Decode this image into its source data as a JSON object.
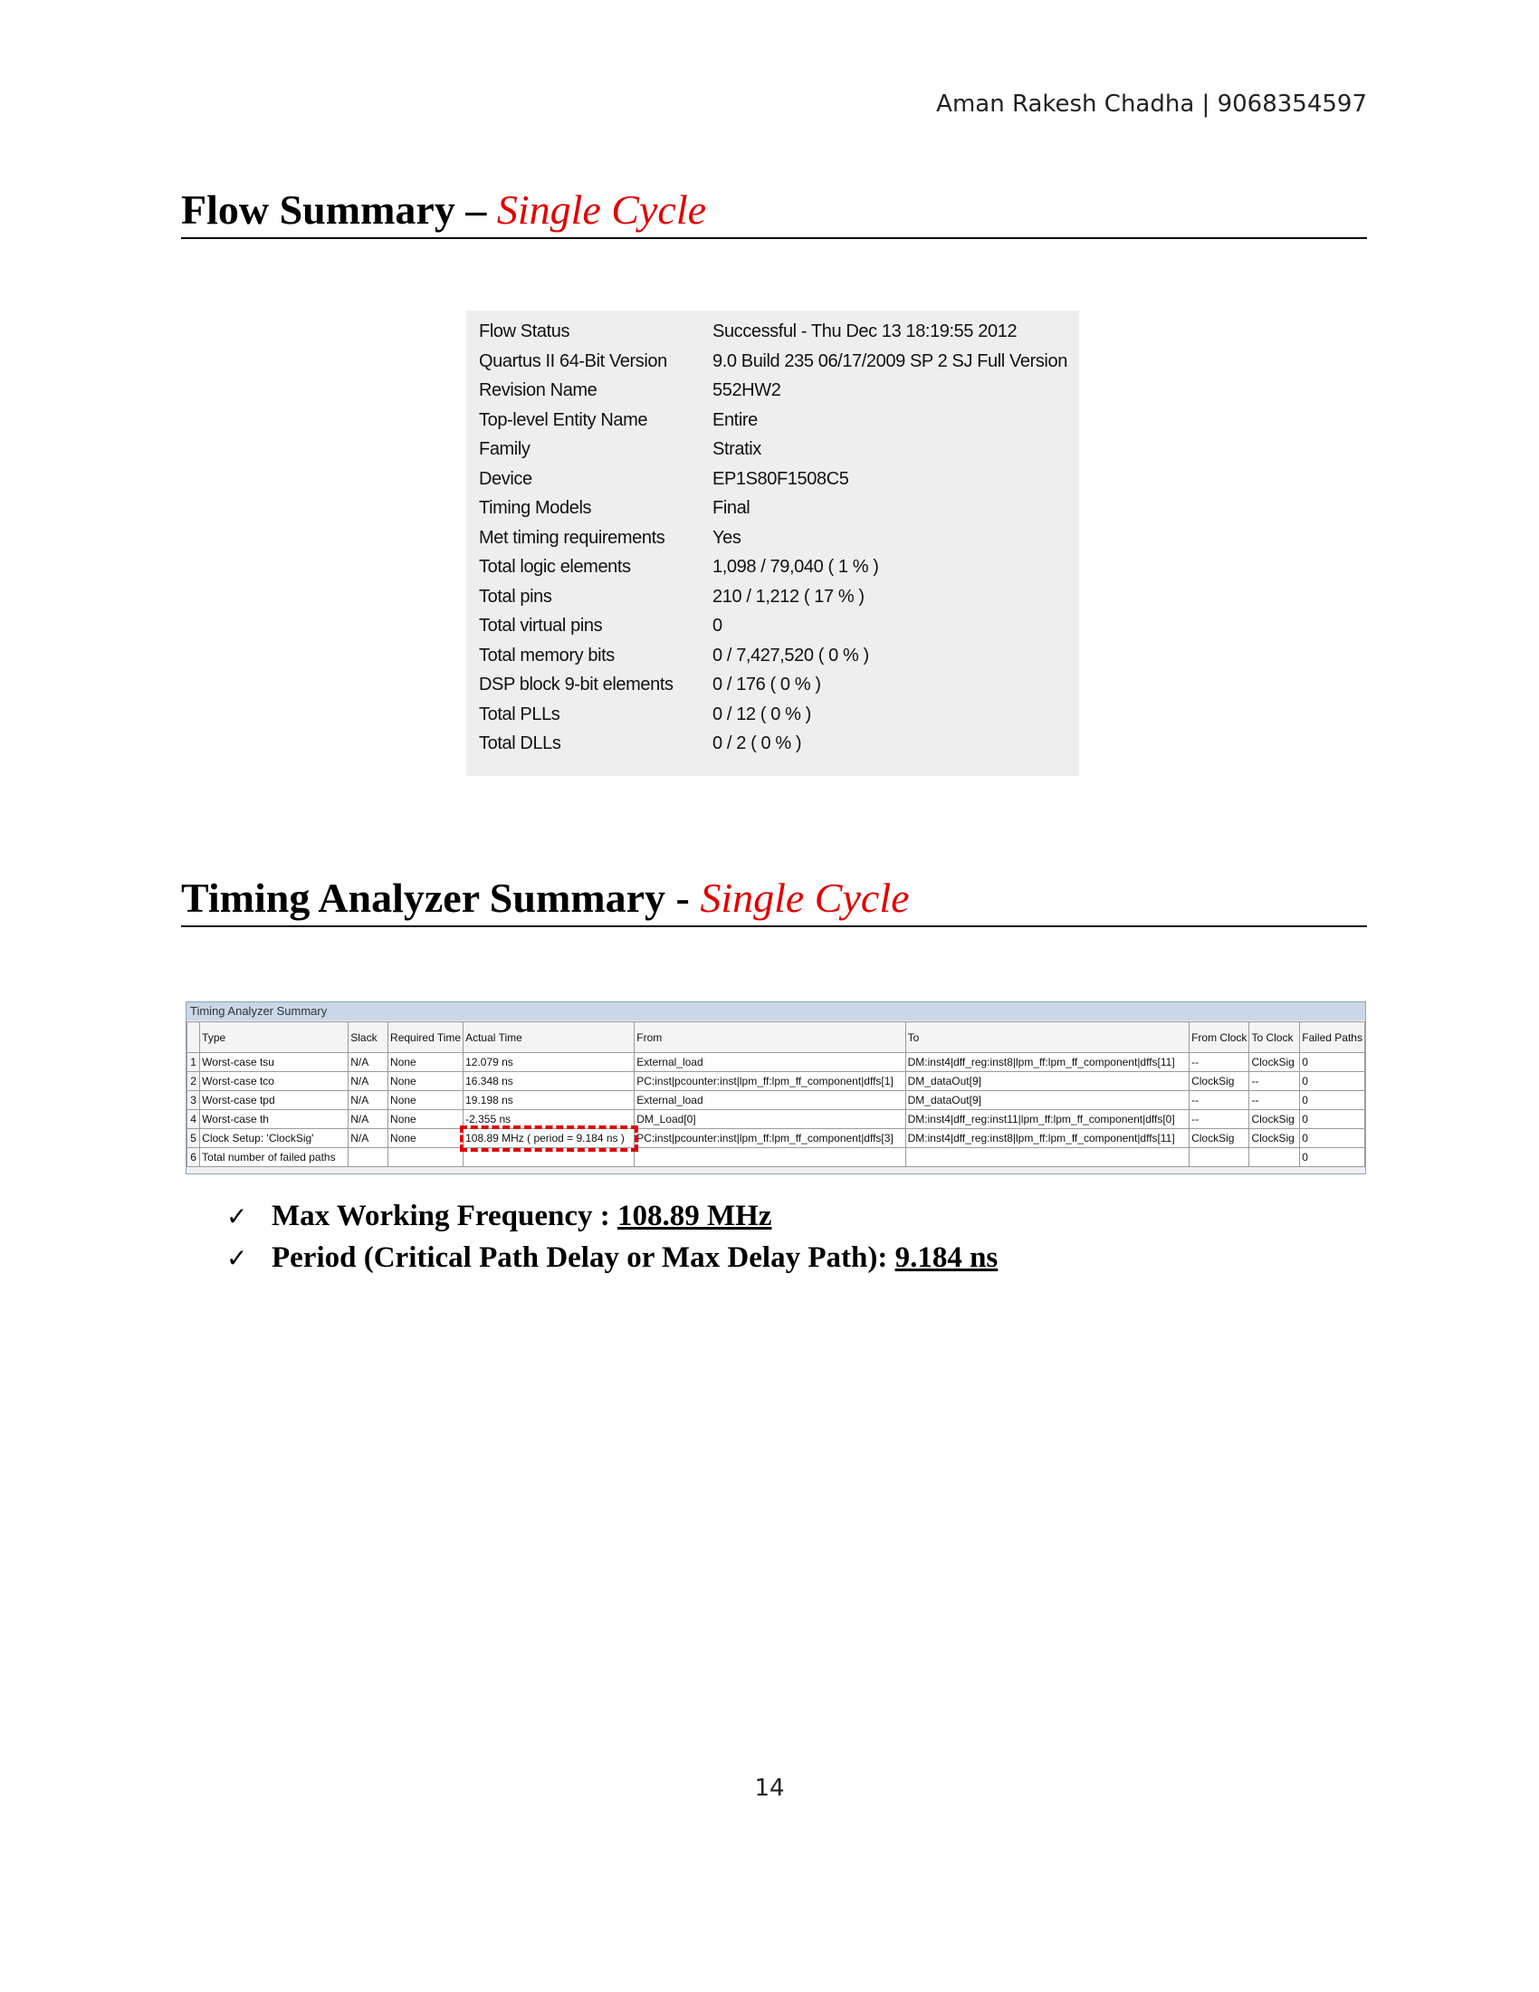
{
  "header": {
    "author_line": "Aman Rakesh Chadha | 9068354597"
  },
  "flow_section": {
    "title_prefix": "Flow Summary – ",
    "title_accent": "Single Cycle"
  },
  "flow_summary": [
    {
      "label": "Flow Status",
      "value": "Successful - Thu Dec 13 18:19:55 2012"
    },
    {
      "label": "Quartus II 64-Bit Version",
      "value": "9.0 Build 235 06/17/2009 SP 2 SJ Full Version"
    },
    {
      "label": "Revision Name",
      "value": "552HW2"
    },
    {
      "label": "Top-level Entity Name",
      "value": "Entire"
    },
    {
      "label": "Family",
      "value": "Stratix"
    },
    {
      "label": "Device",
      "value": "EP1S80F1508C5"
    },
    {
      "label": "Timing Models",
      "value": "Final"
    },
    {
      "label": "Met timing requirements",
      "value": "Yes"
    },
    {
      "label": "Total logic elements",
      "value": "1,098 / 79,040 ( 1 % )"
    },
    {
      "label": "Total pins",
      "value": "210 / 1,212 ( 17 % )"
    },
    {
      "label": "Total virtual pins",
      "value": "0"
    },
    {
      "label": "Total memory bits",
      "value": "0 / 7,427,520 ( 0 % )"
    },
    {
      "label": "DSP block 9-bit elements",
      "value": "0 / 176 ( 0 % )"
    },
    {
      "label": "Total PLLs",
      "value": "0 / 12 ( 0 % )"
    },
    {
      "label": "Total DLLs",
      "value": "0 / 2 ( 0 % )"
    }
  ],
  "timing_section": {
    "title_prefix": "Timing Analyzer Summary - ",
    "title_accent": "Single Cycle"
  },
  "timing_table": {
    "caption": "Timing Analyzer Summary",
    "headers": [
      "",
      "Type",
      "Slack",
      "Required Time",
      "Actual Time",
      "From",
      "To",
      "From Clock",
      "To Clock",
      "Failed Paths"
    ],
    "rows": [
      [
        "1",
        "Worst-case tsu",
        "N/A",
        "None",
        "12.079 ns",
        "External_load",
        "DM:inst4|dff_reg:inst8|lpm_ff:lpm_ff_component|dffs[11]",
        "--",
        "ClockSig",
        "0"
      ],
      [
        "2",
        "Worst-case tco",
        "N/A",
        "None",
        "16.348 ns",
        "PC:inst|pcounter:inst|lpm_ff:lpm_ff_component|dffs[1]",
        "DM_dataOut[9]",
        "ClockSig",
        "--",
        "0"
      ],
      [
        "3",
        "Worst-case tpd",
        "N/A",
        "None",
        "19.198 ns",
        "External_load",
        "DM_dataOut[9]",
        "--",
        "--",
        "0"
      ],
      [
        "4",
        "Worst-case th",
        "N/A",
        "None",
        "-2.355 ns",
        "DM_Load[0]",
        "DM:inst4|dff_reg:inst11|lpm_ff:lpm_ff_component|dffs[0]",
        "--",
        "ClockSig",
        "0"
      ],
      [
        "5",
        "Clock Setup: 'ClockSig'",
        "N/A",
        "None",
        "108.89 MHz ( period = 9.184 ns )",
        "PC:inst|pcounter:inst|lpm_ff:lpm_ff_component|dffs[3]",
        "DM:inst4|dff_reg:inst8|lpm_ff:lpm_ff_component|dffs[11]",
        "ClockSig",
        "ClockSig",
        "0"
      ],
      [
        "6",
        "Total number of failed paths",
        "",
        "",
        "",
        "",
        "",
        "",
        "",
        "0"
      ]
    ]
  },
  "bullets": [
    {
      "label": "Max Working Frequency : ",
      "value": "108.89 MHz"
    },
    {
      "label": "Period (Critical Path Delay or Max Delay Path): ",
      "value": "9.184 ns"
    }
  ],
  "page_number": "14"
}
